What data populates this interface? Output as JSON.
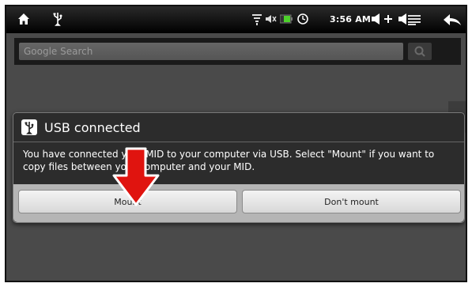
{
  "status_bar": {
    "time": "3:56 AM",
    "icons": [
      "home-icon",
      "usb-icon",
      "wifi-icon",
      "mute-icon",
      "battery-icon",
      "alarm-icon",
      "volume-up-icon",
      "volume-down-icon",
      "menu-icon",
      "back-icon"
    ]
  },
  "search": {
    "placeholder": "Google Search"
  },
  "dialog": {
    "title": "USB connected",
    "message": "You have connected your MID to your computer via USB. Select \"Mount\" if you want to copy files between your computer and your MID.",
    "mount_label": "Mount",
    "dont_mount_label": "Don't mount"
  },
  "annotation": {
    "arrow_color": "#e0140f",
    "arrow_icon": "arrow-down-icon"
  }
}
